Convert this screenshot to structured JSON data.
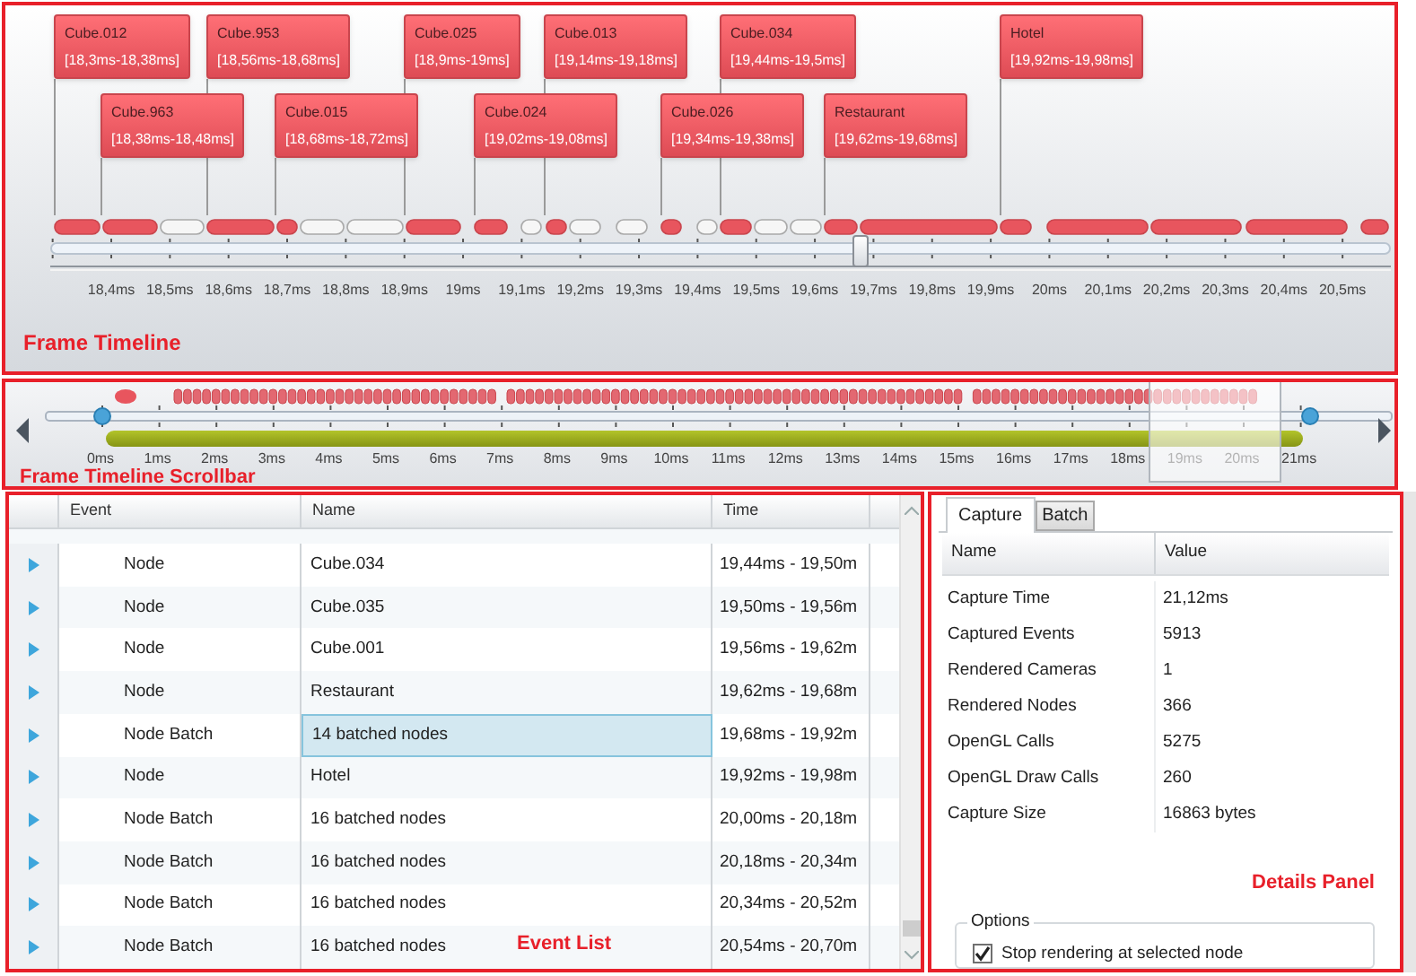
{
  "frame_timeline": {
    "label": "Frame Timeline",
    "callouts": [
      {
        "name": "Cube.012",
        "range": "[18,3ms-18,38ms]"
      },
      {
        "name": "Cube.963",
        "range": "[18,38ms-18,48ms]"
      },
      {
        "name": "Cube.953",
        "range": "[18,56ms-18,68ms]"
      },
      {
        "name": "Cube.015",
        "range": "[18,68ms-18,72ms]"
      },
      {
        "name": "Cube.025",
        "range": "[18,9ms-19ms]"
      },
      {
        "name": "Cube.024",
        "range": "[19,02ms-19,08ms]"
      },
      {
        "name": "Cube.013",
        "range": "[19,14ms-19,18ms]"
      },
      {
        "name": "Cube.026",
        "range": "[19,34ms-19,38ms]"
      },
      {
        "name": "Cube.034",
        "range": "[19,44ms-19,5ms]"
      },
      {
        "name": "Restaurant",
        "range": "[19,62ms-19,68ms]"
      },
      {
        "name": "Hotel",
        "range": "[19,92ms-19,98ms]"
      }
    ],
    "ticks": [
      "18,4ms",
      "18,5ms",
      "18,6ms",
      "18,7ms",
      "18,8ms",
      "18,9ms",
      "19ms",
      "19,1ms",
      "19,2ms",
      "19,3ms",
      "19,4ms",
      "19,5ms",
      "19,6ms",
      "19,7ms",
      "19,8ms",
      "19,9ms",
      "20ms",
      "20,1ms",
      "20,2ms",
      "20,3ms",
      "20,4ms",
      "20,5ms"
    ]
  },
  "scrollbar": {
    "label": "Frame Timeline Scrollbar",
    "ticks": [
      "0ms",
      "1ms",
      "2ms",
      "3ms",
      "4ms",
      "5ms",
      "6ms",
      "7ms",
      "8ms",
      "9ms",
      "10ms",
      "11ms",
      "12ms",
      "13ms",
      "14ms",
      "15ms",
      "16ms",
      "17ms",
      "18ms",
      "19ms",
      "20ms",
      "21ms"
    ]
  },
  "event_list": {
    "label": "Event List",
    "columns": [
      "Event",
      "Name",
      "Time"
    ],
    "rows": [
      {
        "event": "Node",
        "name": "Cube.034",
        "time": "19,44ms - 19,50m",
        "selected": false
      },
      {
        "event": "Node",
        "name": "Cube.035",
        "time": "19,50ms - 19,56m",
        "selected": false
      },
      {
        "event": "Node",
        "name": "Cube.001",
        "time": "19,56ms - 19,62m",
        "selected": false
      },
      {
        "event": "Node",
        "name": "Restaurant",
        "time": "19,62ms - 19,68m",
        "selected": false
      },
      {
        "event": "Node Batch",
        "name": "14 batched nodes",
        "time": "19,68ms - 19,92m",
        "selected": true
      },
      {
        "event": "Node",
        "name": "Hotel",
        "time": "19,92ms - 19,98m",
        "selected": false
      },
      {
        "event": "Node Batch",
        "name": "16 batched nodes",
        "time": "20,00ms - 20,18m",
        "selected": false
      },
      {
        "event": "Node Batch",
        "name": "16 batched nodes",
        "time": "20,18ms - 20,34m",
        "selected": false
      },
      {
        "event": "Node Batch",
        "name": "16 batched nodes",
        "time": "20,34ms - 20,52m",
        "selected": false
      },
      {
        "event": "Node Batch",
        "name": "16 batched nodes",
        "time": "20,54ms - 20,70m",
        "selected": false
      }
    ]
  },
  "details_panel": {
    "label": "Details Panel",
    "tabs": [
      {
        "label": "Capture",
        "selected": true
      },
      {
        "label": "Batch",
        "selected": false
      }
    ],
    "columns": [
      "Name",
      "Value"
    ],
    "properties": [
      {
        "name": "Capture Time",
        "value": "21,12ms"
      },
      {
        "name": "Captured Events",
        "value": "5913"
      },
      {
        "name": "Rendered Cameras",
        "value": "1"
      },
      {
        "name": "Rendered Nodes",
        "value": "366"
      },
      {
        "name": "OpenGL Calls",
        "value": "5275"
      },
      {
        "name": "OpenGL Draw Calls",
        "value": "260"
      },
      {
        "name": "Capture Size",
        "value": "16863 bytes"
      }
    ],
    "options": {
      "title": "Options",
      "checkbox": {
        "label": "Stop rendering at selected node",
        "checked": true
      }
    }
  }
}
